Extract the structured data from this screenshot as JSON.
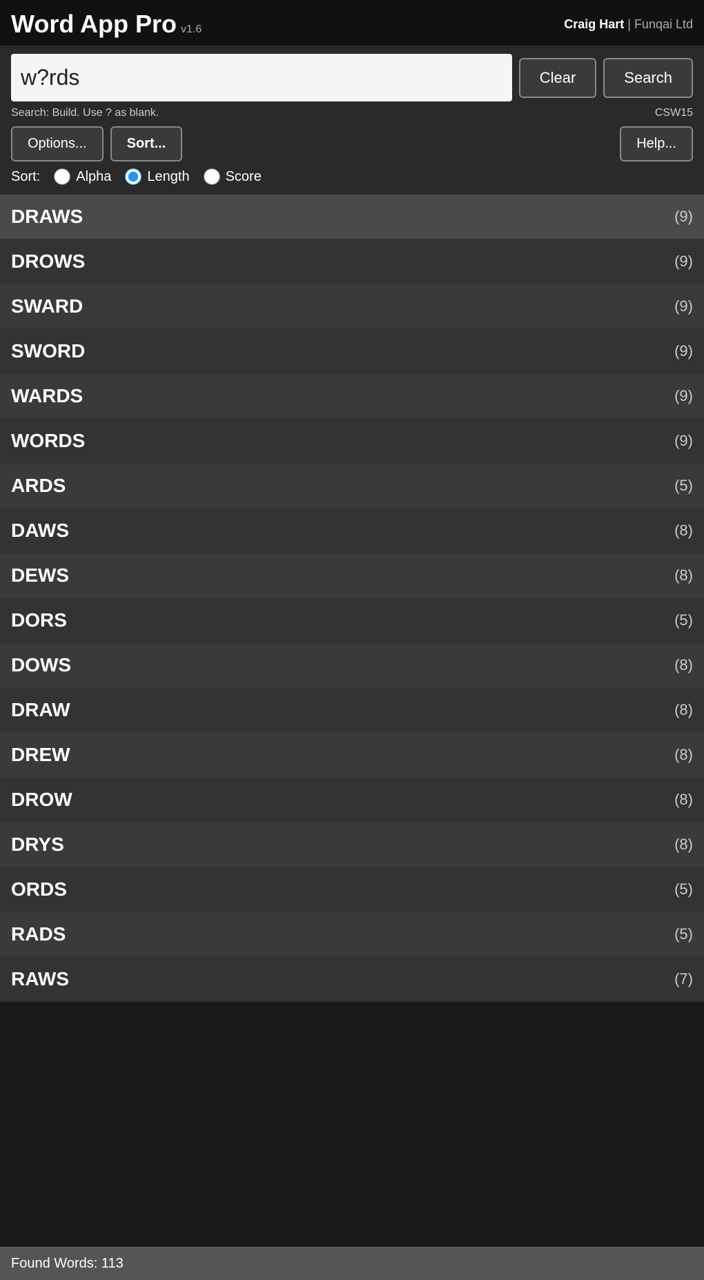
{
  "header": {
    "title": "Word App Pro",
    "version": "v1.6",
    "user": "Craig Hart",
    "company": "Funqai Ltd"
  },
  "search": {
    "input_value": "w?rds",
    "hint": "Search: Build. Use ? as blank.",
    "dictionary": "CSW15",
    "clear_label": "Clear",
    "search_label": "Search"
  },
  "controls": {
    "options_label": "Options...",
    "sort_label": "Sort...",
    "help_label": "Help..."
  },
  "sort": {
    "label": "Sort:",
    "options": [
      {
        "id": "alpha",
        "label": "Alpha",
        "checked": false
      },
      {
        "id": "length",
        "label": "Length",
        "checked": true
      },
      {
        "id": "score",
        "label": "Score",
        "checked": false
      }
    ]
  },
  "words": [
    {
      "word": "DRAWS",
      "score": "(9)"
    },
    {
      "word": "DROWS",
      "score": "(9)"
    },
    {
      "word": "SWARD",
      "score": "(9)"
    },
    {
      "word": "SWORD",
      "score": "(9)"
    },
    {
      "word": "WARDS",
      "score": "(9)"
    },
    {
      "word": "WORDS",
      "score": "(9)"
    },
    {
      "word": "ARDS",
      "score": "(5)"
    },
    {
      "word": "DAWS",
      "score": "(8)"
    },
    {
      "word": "DEWS",
      "score": "(8)"
    },
    {
      "word": "DORS",
      "score": "(5)"
    },
    {
      "word": "DOWS",
      "score": "(8)"
    },
    {
      "word": "DRAW",
      "score": "(8)"
    },
    {
      "word": "DREW",
      "score": "(8)"
    },
    {
      "word": "DROW",
      "score": "(8)"
    },
    {
      "word": "DRYS",
      "score": "(8)"
    },
    {
      "word": "ORDS",
      "score": "(5)"
    },
    {
      "word": "RADS",
      "score": "(5)"
    },
    {
      "word": "RAWS",
      "score": "(7)"
    }
  ],
  "footer": {
    "found_words_label": "Found Words: 113"
  }
}
